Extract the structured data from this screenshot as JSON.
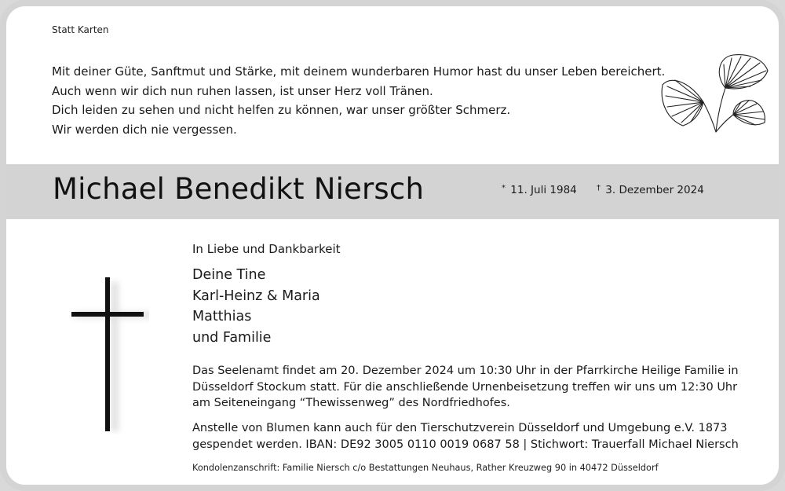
{
  "header": {
    "label": "Statt Karten"
  },
  "poem": [
    "Mit deiner Güte, Sanftmut und Stärke, mit deinem wunderbaren Humor hast du unser Leben bereichert.",
    "Auch wenn wir dich nun ruhen lassen, ist unser Herz voll Tränen.",
    "Dich leiden zu sehen und nicht helfen zu können, war unser größter Schmerz.",
    "Wir werden dich nie vergessen."
  ],
  "deceased": {
    "name": "Michael Benedikt Niersch",
    "birth_symbol": "*",
    "birth_date": "11. Juli 1984",
    "death_symbol": "†",
    "death_date": "3. Dezember 2024"
  },
  "intro": "In Liebe und Dankbarkeit",
  "mourners": [
    "Deine Tine",
    "Karl-Heinz & Maria",
    "Matthias",
    "und Familie"
  ],
  "service_lines": [
    "Das Seelenamt findet am 20. Dezember 2024 um 10:30 Uhr in der Pfarrkirche Heilige Familie in",
    "Düsseldorf Stockum statt. Für die anschließende Urnenbeisetzung treffen wir uns um 12:30 Uhr",
    "am Seiteneingang “Thewissenweg” des Nordfriedhofes."
  ],
  "donation_lines": [
    "Anstelle von Blumen kann auch für den Tierschutzverein Düsseldorf und Umgebung e.V. 1873",
    "gespendet werden. IBAN: DE92 3005 0110 0019 0687 58 | Stichwort: Trauerfall Michael Niersch"
  ],
  "condolence_address": "Kondolenzanschrift: Familie Niersch c/o Bestattungen Neuhaus, Rather Kreuzweg 90 in 40472 Düsseldorf",
  "icons": {
    "cross": "cross-icon",
    "leaves": "ginkgo-leaves-icon"
  },
  "colors": {
    "band": "#d3d3d3",
    "border": "#d4d4d4",
    "text": "#1a1a1a"
  }
}
